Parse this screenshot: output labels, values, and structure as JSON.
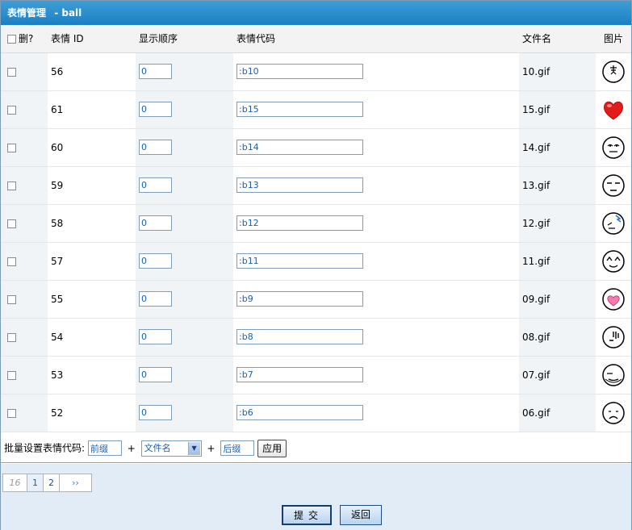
{
  "title": {
    "main": "表情管理",
    "sub": "- ball"
  },
  "table": {
    "headers": {
      "delete": "删?",
      "id": "表情 ID",
      "order": "显示顺序",
      "code": "表情代码",
      "filename": "文件名",
      "image": "图片"
    },
    "rows": [
      {
        "id": "56",
        "order": "0",
        "code": ":b10",
        "file": "10.gif",
        "icon": "angry-face-icon"
      },
      {
        "id": "61",
        "order": "0",
        "code": ":b15",
        "file": "15.gif",
        "icon": "red-heart-icon"
      },
      {
        "id": "60",
        "order": "0",
        "code": ":b14",
        "file": "14.gif",
        "icon": "dizzy-face-icon"
      },
      {
        "id": "59",
        "order": "0",
        "code": ":b13",
        "file": "13.gif",
        "icon": "sleepy-face-icon"
      },
      {
        "id": "58",
        "order": "0",
        "code": ":b12",
        "file": "12.gif",
        "icon": "sweat-face-icon"
      },
      {
        "id": "57",
        "order": "0",
        "code": ":b11",
        "file": "11.gif",
        "icon": "happy-face-icon"
      },
      {
        "id": "55",
        "order": "0",
        "code": ":b9",
        "file": "09.gif",
        "icon": "love-face-icon"
      },
      {
        "id": "54",
        "order": "0",
        "code": ":b8",
        "file": "08.gif",
        "icon": "nervous-face-icon"
      },
      {
        "id": "53",
        "order": "0",
        "code": ":b7",
        "file": "07.gif",
        "icon": "bored-face-icon"
      },
      {
        "id": "52",
        "order": "0",
        "code": ":b6",
        "file": "06.gif",
        "icon": "sad-face-icon"
      }
    ]
  },
  "batch": {
    "label": "批量设置表情代码:",
    "prefix_value": "前缀",
    "plus1": "+",
    "select_value": "文件名",
    "plus2": "+",
    "suffix_value": "后缀",
    "apply_label": "应用"
  },
  "pager": {
    "total": "16",
    "pages": [
      "1",
      "2"
    ],
    "next": "››"
  },
  "actions": {
    "submit_label": "提交",
    "back_label": "返回"
  }
}
